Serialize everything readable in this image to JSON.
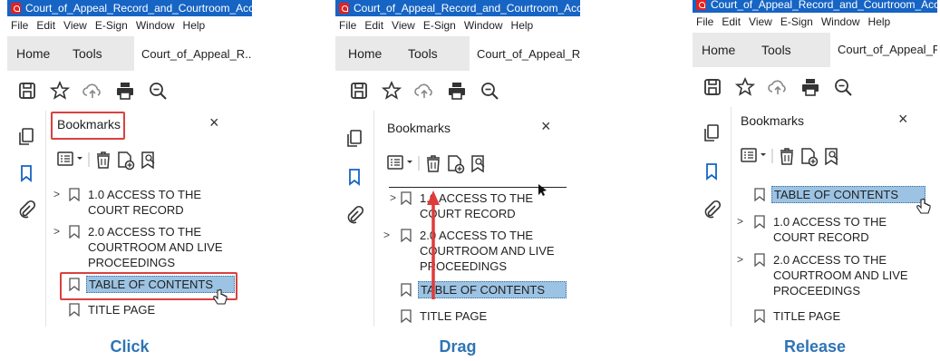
{
  "panels": [
    {
      "window_title": "Court_of_Appeal_Record_and_Courtroom_Access_Policy.",
      "menu": [
        "File",
        "Edit",
        "View",
        "E-Sign",
        "Window",
        "Help"
      ],
      "tabs": {
        "home": "Home",
        "tools": "Tools",
        "document": "Court_of_Appeal_R...",
        "close": "×"
      },
      "bookmarks_title": "Bookmarks",
      "close": "×",
      "items": [
        {
          "chevron": ">",
          "label": "1.0 ACCESS TO THE COURT RECORD"
        },
        {
          "chevron": ">",
          "label": "2.0 ACCESS TO THE COURTROOM AND LIVE PROCEEDINGS"
        },
        {
          "chevron": "",
          "label": "TABLE OF CONTENTS",
          "selected": true
        },
        {
          "chevron": "",
          "label": "TITLE PAGE"
        }
      ],
      "caption": "Click"
    },
    {
      "window_title": "Court_of_Appeal_Record_and_Courtroom_Access_Policy.",
      "menu": [
        "File",
        "Edit",
        "View",
        "E-Sign",
        "Window",
        "Help"
      ],
      "tabs": {
        "home": "Home",
        "tools": "Tools",
        "document": "Court_of_Appeal_R...",
        "close": "×"
      },
      "bookmarks_title": "Bookmarks",
      "close": "×",
      "items": [
        {
          "chevron": ">",
          "label": "1.0 ACCESS TO THE COURT RECORD"
        },
        {
          "chevron": ">",
          "label": "2.0 ACCESS TO THE COURTROOM AND LIVE PROCEEDINGS"
        },
        {
          "chevron": "",
          "label": "TABLE OF CONTENTS",
          "selected": true
        },
        {
          "chevron": "",
          "label": "TITLE PAGE"
        }
      ],
      "caption": "Drag"
    },
    {
      "window_title": "Court_of_Appeal_Record_and_Courtroom_Access_Po",
      "menu": [
        "File",
        "Edit",
        "View",
        "E-Sign",
        "Window",
        "Help"
      ],
      "tabs": {
        "home": "Home",
        "tools": "Tools",
        "document": "Court_of_Appeal_R..."
      },
      "bookmarks_title": "Bookmarks",
      "close": "×",
      "items": [
        {
          "chevron": "",
          "label": "TABLE OF CONTENTS",
          "selected": true
        },
        {
          "chevron": ">",
          "label": "1.0 ACCESS TO THE COURT RECORD"
        },
        {
          "chevron": ">",
          "label": "2.0 ACCESS TO THE COURTROOM AND LIVE PROCEEDINGS"
        },
        {
          "chevron": "",
          "label": "TITLE PAGE"
        }
      ],
      "caption": "Release"
    }
  ],
  "colors": {
    "titlebar": "#1664c4",
    "selection": "#9cc3e3",
    "highlight": "#d9413f",
    "caption": "#2f74b5",
    "arrow": "#e03a3a"
  }
}
